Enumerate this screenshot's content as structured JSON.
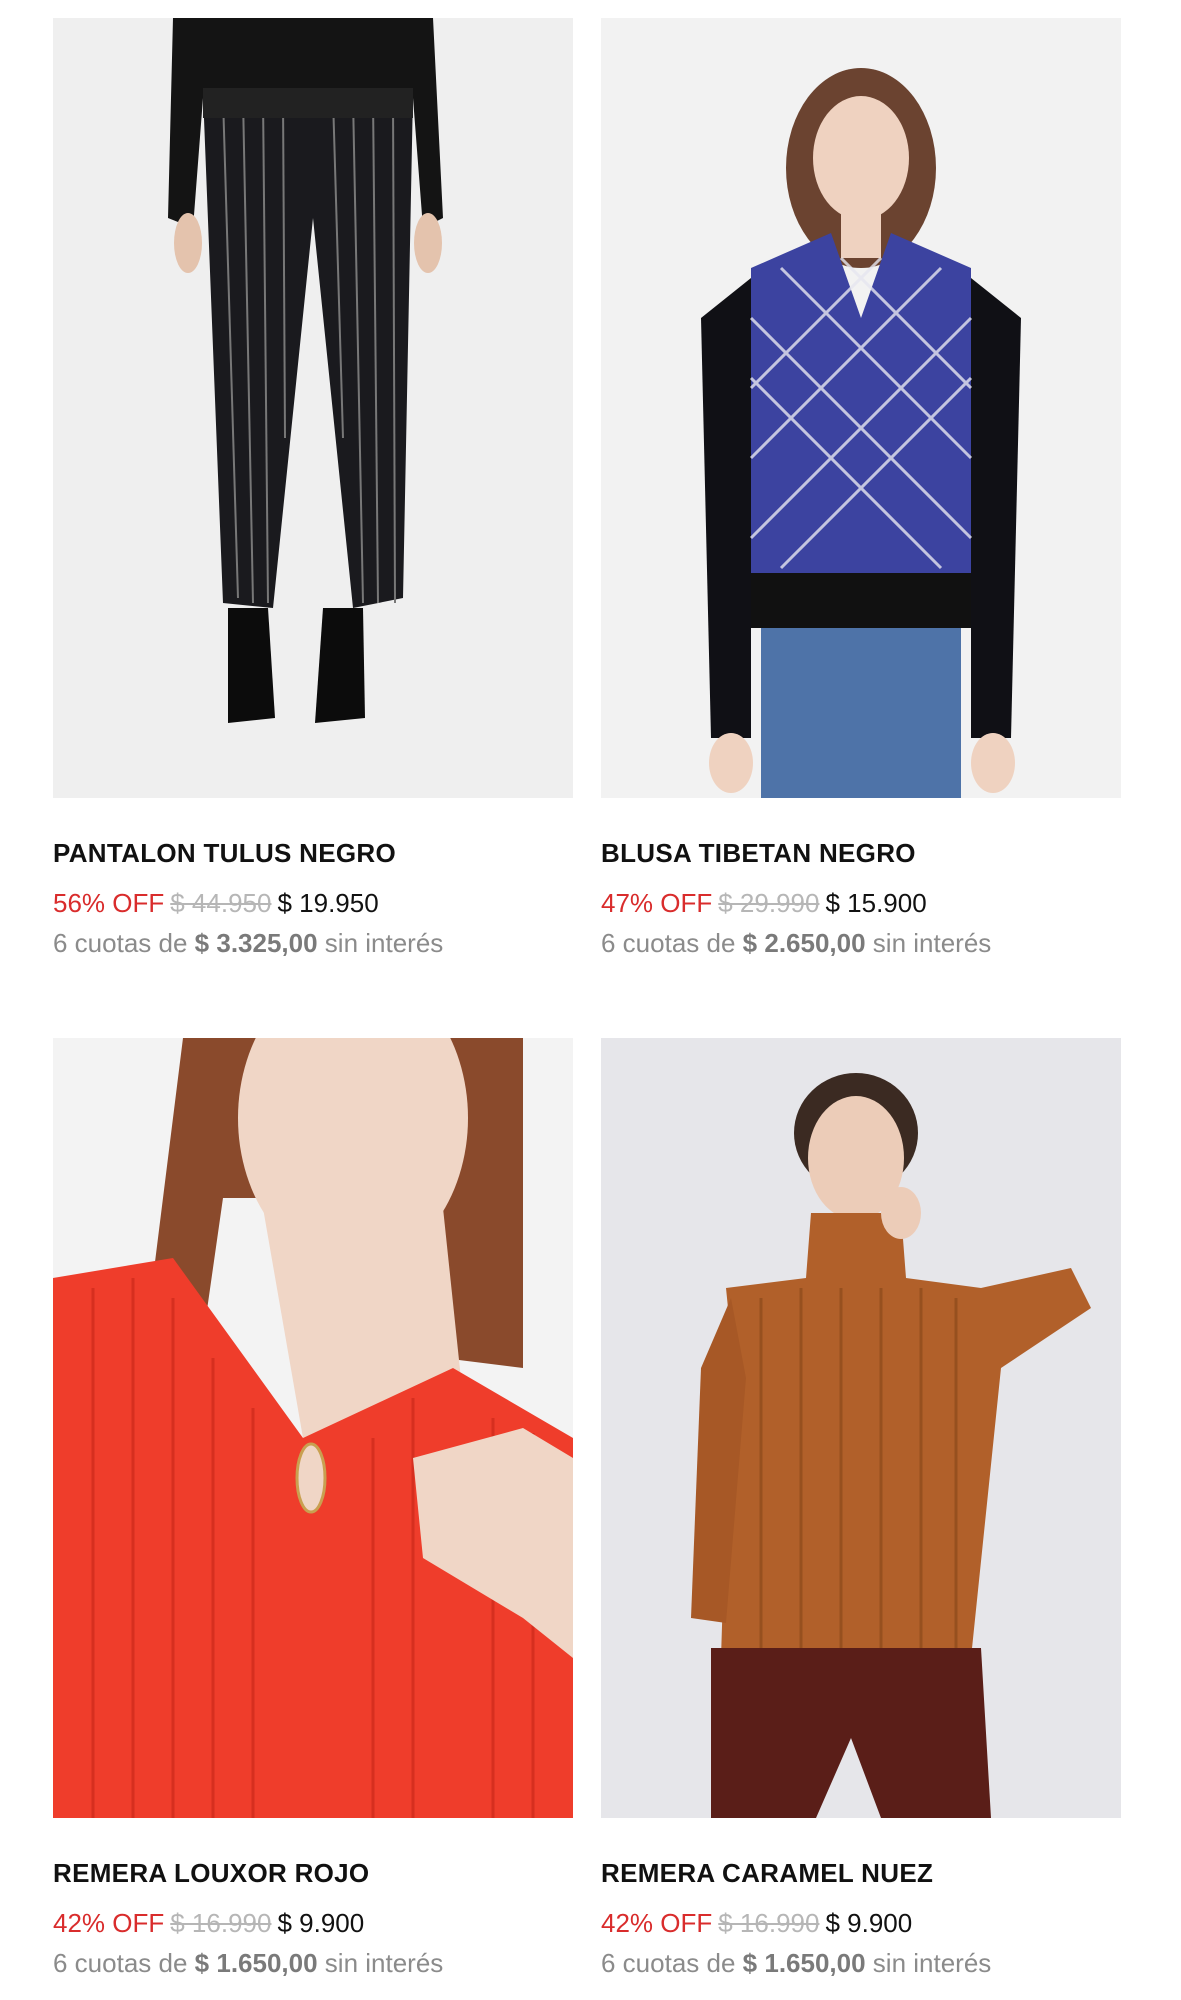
{
  "products": [
    {
      "name": "PANTALON TULUS NEGRO",
      "discount": "56% OFF",
      "old_price": "$ 44.950",
      "price": "$ 19.950",
      "installments_prefix": "6 cuotas de",
      "installment_amount": "$ 3.325,00",
      "installments_suffix": "sin interés"
    },
    {
      "name": "BLUSA TIBETAN NEGRO",
      "discount": "47% OFF",
      "old_price": "$ 29.990",
      "price": "$ 15.900",
      "installments_prefix": "6 cuotas de",
      "installment_amount": "$ 2.650,00",
      "installments_suffix": "sin interés"
    },
    {
      "name": "REMERA LOUXOR ROJO",
      "discount": "42% OFF",
      "old_price": "$ 16.990",
      "price": "$ 9.900",
      "installments_prefix": "6 cuotas de",
      "installment_amount": "$ 1.650,00",
      "installments_suffix": "sin interés"
    },
    {
      "name": "REMERA CARAMEL NUEZ",
      "discount": "42% OFF",
      "old_price": "$ 16.990",
      "price": "$ 9.900",
      "installments_prefix": "6 cuotas de",
      "installment_amount": "$ 1.650,00",
      "installments_suffix": "sin interés"
    }
  ],
  "colors": {
    "discount": "#d92c2c",
    "old_price": "#b6b6b6",
    "installments": "#8b8b8b"
  }
}
